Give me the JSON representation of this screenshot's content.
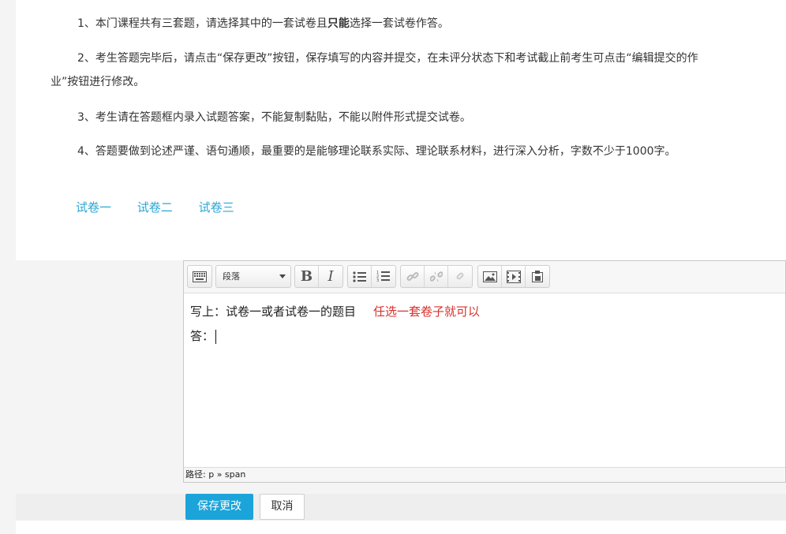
{
  "instructions": {
    "p1_before": "1、本门课程共有三套题，请选择其中的一套试卷且",
    "p1_bold": "只能",
    "p1_after": "选择一套试卷作答。",
    "p2": "2、考生答题完毕后，请点击“保存更改”按钮，保存填写的内容并提交，在未评分状态下和考试截止前考生可点击“编辑提交的作业”按钮进行修改。",
    "p3": "3、考生请在答题框内录入试题答案，不能复制黏贴，不能以附件形式提交试卷。",
    "p4": "4、答题要做到论述严谨、语句通顺，最重要的是能够理论联系实际、理论联系材料，进行深入分析，字数不少于1000字。"
  },
  "papers": [
    "试卷一",
    "试卷二",
    "试卷三"
  ],
  "editor": {
    "format_select": "段落",
    "line1": "写上：试卷一或者试卷一的题目",
    "note": "任选一套卷子就可以",
    "line2": "答：",
    "path_label": "路径:",
    "path_value": "p » span"
  },
  "toolbar_icons": [
    "keyboard-icon",
    "bold-icon",
    "italic-icon",
    "bullet-list-icon",
    "numbered-list-icon",
    "link-icon",
    "unlink-icon",
    "anchor-icon",
    "image-icon",
    "media-icon",
    "paste-icon"
  ],
  "buttons": {
    "save": "保存更改",
    "cancel": "取消"
  },
  "colors": {
    "accent": "#1ba4d9",
    "link": "#2aa7d6",
    "note_red": "#d9302c"
  }
}
